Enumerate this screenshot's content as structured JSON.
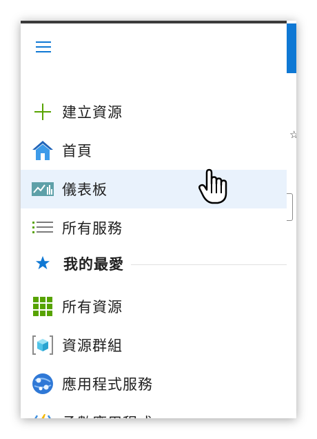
{
  "menu": {
    "items": [
      {
        "label": "建立資源",
        "icon": "plus-icon"
      },
      {
        "label": "首頁",
        "icon": "home-icon"
      },
      {
        "label": "儀表板",
        "icon": "dashboard-icon"
      },
      {
        "label": "所有服務",
        "icon": "list-icon"
      }
    ],
    "favorites_header": {
      "label": "我的最愛",
      "icon": "star-icon"
    },
    "favorites": [
      {
        "label": "所有資源",
        "icon": "grid-icon"
      },
      {
        "label": "資源群組",
        "icon": "resource-group-icon"
      },
      {
        "label": "應用程式服務",
        "icon": "app-service-icon"
      },
      {
        "label": "函數應用程式",
        "icon": "function-app-icon"
      }
    ]
  },
  "colors": {
    "accent": "#0f78d4",
    "hover_bg": "#e9f2fc",
    "plus_green": "#57a300",
    "topbar": "#3b3b3b"
  },
  "hovered_item": "儀表板",
  "background_glyph": "☆"
}
